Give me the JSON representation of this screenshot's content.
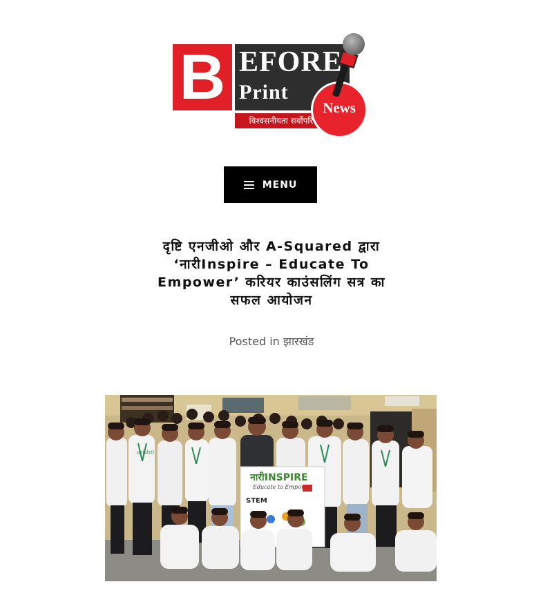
{
  "logo": {
    "letter": "B",
    "word1": "EFORE",
    "word2": "Print",
    "badge": "News",
    "tagline": "विश्वसनीयता सर्वोपरि",
    "colors": {
      "red": "#e11f26",
      "dark": "#2e2e2e",
      "white": "#ffffff"
    }
  },
  "nav": {
    "menu_label": "MENU",
    "menu_icon": "hamburger-icon"
  },
  "post": {
    "title_lines": [
      "दृष्टि एनजीओ और A-Squared द्वारा",
      "‘नारीInspire – Educate To",
      "Empower’ करियर काउंसलिंग सत्र का",
      "सफल आयोजन"
    ],
    "meta_prefix": "Posted in",
    "category": "झारखंड"
  },
  "featured_image": {
    "banner_title": "नारीINSPIRE",
    "banner_subtitle": "Educate to Empower",
    "banner_stem": "STEM",
    "tshirt_text": "drishti"
  }
}
